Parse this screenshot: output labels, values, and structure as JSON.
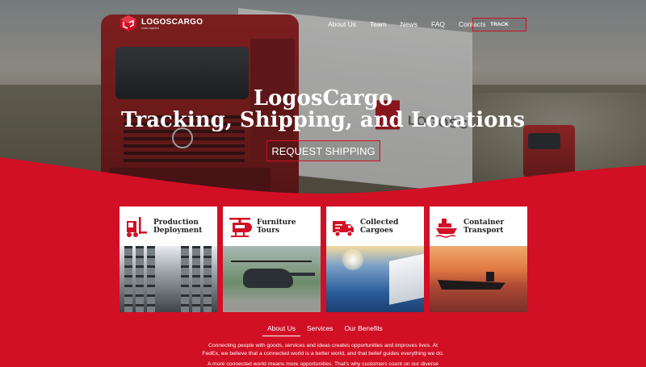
{
  "brand": {
    "name": "LOGOSCARGO",
    "tagline": "smart logistics"
  },
  "nav": {
    "items": [
      "About Us",
      "Team",
      "News",
      "FAQ",
      "Contacts"
    ],
    "track_label": "TRACK"
  },
  "hero": {
    "title": "LogosCargo",
    "subtitle": "Tracking, Shipping, and Locations",
    "button": "REQUEST SHIPPING",
    "trailer_text": "LOGOSC"
  },
  "cards": [
    {
      "label_line1": "Production",
      "label_line2": "Deployment",
      "icon": "forklift-icon"
    },
    {
      "label_line1": "Furniture",
      "label_line2": "Tours",
      "icon": "helicopter-icon"
    },
    {
      "label_line1": "Collected",
      "label_line2": "Cargoes",
      "icon": "delivery-truck-icon"
    },
    {
      "label_line1": "Container",
      "label_line2": "Transport",
      "icon": "cargo-ship-icon"
    }
  ],
  "tabs": [
    "About Us",
    "Services",
    "Our Benefits"
  ],
  "content": {
    "p1_line1": "Connecting people with goods, services and ideas creates opportunities and improves lives. At",
    "p1_line2": "FedEx, we believe that a connected world is a better world, and that belief guides everything we do.",
    "p2_line1": "A more connected world means more opportunities. That's why customers count on our diverse"
  },
  "colors": {
    "accent": "#d10f25",
    "text_on_accent": "#ffffff"
  }
}
